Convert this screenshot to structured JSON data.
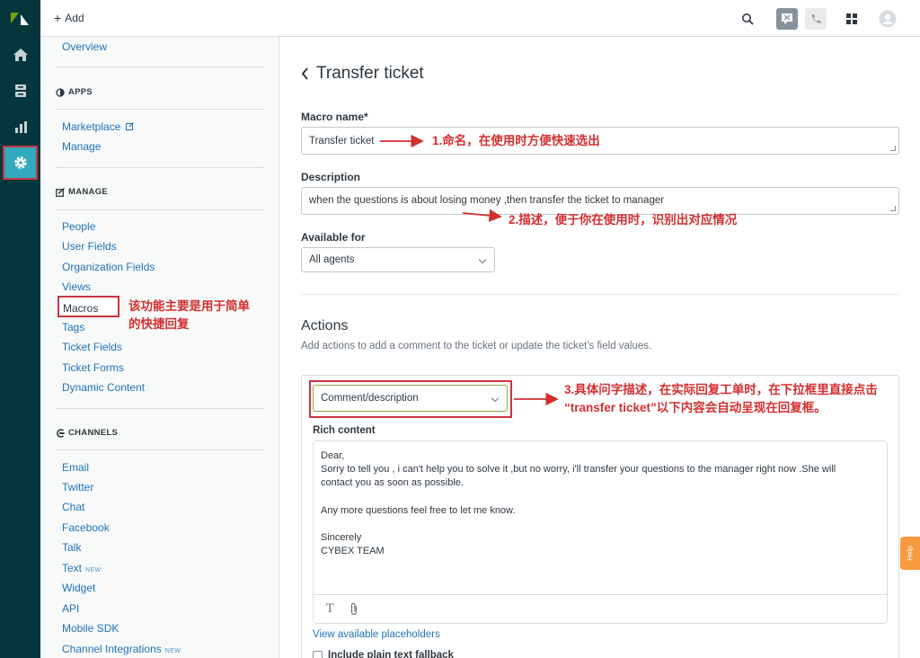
{
  "topbar": {
    "add_label": "Add"
  },
  "admin_nav": {
    "overview": "Overview",
    "apps_heading": "APPS",
    "apps_items": [
      "Marketplace",
      "Manage"
    ],
    "manage_heading": "MANAGE",
    "manage_items": [
      "People",
      "User Fields",
      "Organization Fields",
      "Views",
      "Macros",
      "Tags",
      "Ticket Fields",
      "Ticket Forms",
      "Dynamic Content"
    ],
    "channels_heading": "CHANNELS",
    "channel_items": [
      "Email",
      "Twitter",
      "Chat",
      "Facebook",
      "Talk",
      "Text",
      "Widget",
      "API",
      "Mobile SDK",
      "Channel Integrations"
    ],
    "new_badge": "NEW"
  },
  "annotations": {
    "macros_note_line1": "该功能主要是用于简单",
    "macros_note_line2": "的快捷回复",
    "note1": "1.命名，在使用时方便快速选出",
    "note2": "2.描述，便于你在使用时，识别出对应情况",
    "note3_line1": "3.具体问字描述，在实际回复工单时，在下拉框里直接点击",
    "note3_line2": "“transfer ticket”以下内容会自动呈现在回复框。"
  },
  "main": {
    "title": "Transfer ticket",
    "macro_name_label": "Macro name*",
    "macro_name_value": "Transfer ticket",
    "description_label": "Description",
    "description_value": "when the questions is about losing money ,then transfer the ticket to manager",
    "available_for_label": "Available for",
    "available_for_value": "All agents",
    "actions_title": "Actions",
    "actions_subtitle": "Add actions to add a comment to the ticket or update the ticket's field values.",
    "action_select_value": "Comment/description",
    "rich_content_label": "Rich content",
    "rich_lines": [
      "Dear,",
      "Sorry to tell you , i can't help you to solve it ,but no worry, i'll transfer your questions to the manager right now .She will",
      "contact you  as soon as possible.",
      "",
      "Any more questions feel free to let me know.",
      "",
      "Sincerely",
      "CYBEX TEAM"
    ],
    "placeholders_link": "View available placeholders",
    "plain_text_fallback": "Include plain text fallback"
  },
  "help_label": "Help",
  "colors": {
    "rail": "#03363d",
    "active": "#30aabc",
    "link": "#1f73b7",
    "annotation": "#d32f2f"
  },
  "icons": [
    "zendesk-logo-icon",
    "home-icon",
    "views-icon",
    "reporting-icon",
    "admin-gear-icon",
    "search-icon",
    "chat-icon",
    "phone-icon",
    "apps-grid-icon",
    "avatar-icon",
    "external-link-icon",
    "apps-icon",
    "manage-icon",
    "channels-icon"
  ]
}
